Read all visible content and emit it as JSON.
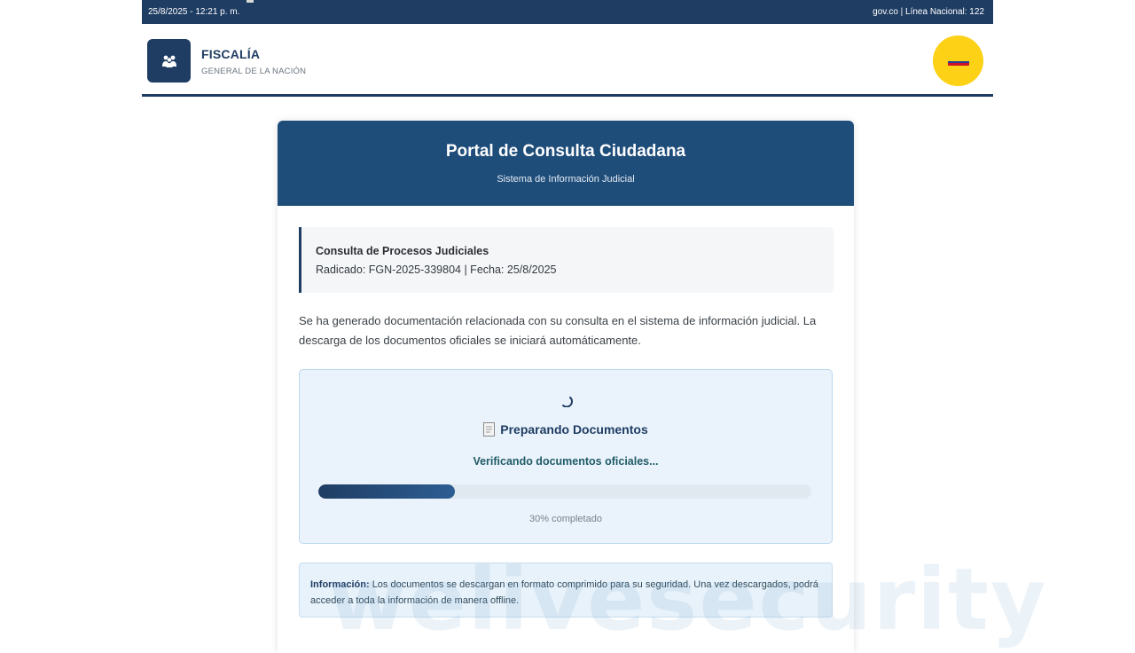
{
  "topbar": {
    "datetime": "25/8/2025 - 12:21 p. m.",
    "right_text": "gov.co | Línea Nacional: 122"
  },
  "header": {
    "brand_title": "FISCALÍA",
    "brand_subtitle": "GENERAL DE LA NACIÓN",
    "logo_icon": "people-group-icon",
    "flag_icon": "colombia-flag-icon"
  },
  "card": {
    "title": "Portal de Consulta Ciudadana",
    "subtitle": "Sistema de Información Judicial"
  },
  "info_box": {
    "title": "Consulta de Procesos Judiciales",
    "radicado_line": "Radicado: FGN-2025-339804 | Fecha: 25/8/2025"
  },
  "description": "Se ha generado documentación relacionada con su consulta en el sistema de información judicial. La descarga de los documentos oficiales se iniciará automáticamente.",
  "progress": {
    "title": "Preparando Documentos",
    "status": "Verificando documentos oficiales...",
    "percent": 30,
    "percent_label": "30% completado"
  },
  "note": {
    "label": "Información:",
    "text": "Los documentos se descargan en formato comprimido para su seguridad. Una vez descargados, podrá acceder a toda la información de manera offline."
  },
  "watermark": "welivesecurity",
  "colors": {
    "primary": "#1f3d63",
    "card_header": "#1f4d7a",
    "flag_yellow": "#fcd116",
    "panel_bg": "#eaf3fb"
  }
}
